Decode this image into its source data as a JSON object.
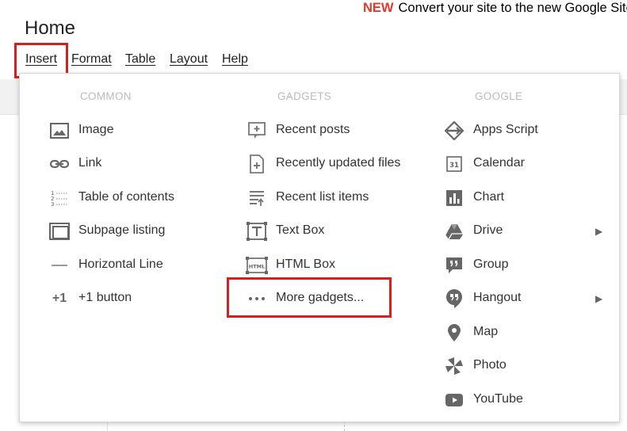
{
  "banner": {
    "new_label": "NEW",
    "text": "Convert your site to the new Google Site"
  },
  "page": {
    "title": "Home"
  },
  "menubar": {
    "items": [
      "Insert",
      "Format",
      "Table",
      "Layout",
      "Help"
    ]
  },
  "dropdown": {
    "columns": [
      {
        "header": "COMMON",
        "items": [
          {
            "label": "Image",
            "icon": "image-icon"
          },
          {
            "label": "Link",
            "icon": "link-icon"
          },
          {
            "label": "Table of contents",
            "icon": "table-of-contents-icon"
          },
          {
            "label": "Subpage listing",
            "icon": "subpage-listing-icon"
          },
          {
            "label": "Horizontal Line",
            "icon": "horizontal-line-icon"
          },
          {
            "label": "+1 button",
            "icon": "plus-one-icon"
          }
        ]
      },
      {
        "header": "GADGETS",
        "items": [
          {
            "label": "Recent posts",
            "icon": "recent-posts-icon"
          },
          {
            "label": "Recently updated files",
            "icon": "recent-files-icon"
          },
          {
            "label": "Recent list items",
            "icon": "recent-list-icon"
          },
          {
            "label": "Text Box",
            "icon": "text-box-icon"
          },
          {
            "label": "HTML Box",
            "icon": "html-box-icon"
          },
          {
            "label": "More gadgets...",
            "icon": "more-dots-icon"
          }
        ]
      },
      {
        "header": "GOOGLE",
        "items": [
          {
            "label": "Apps Script",
            "icon": "apps-script-icon"
          },
          {
            "label": "Calendar",
            "icon": "calendar-icon"
          },
          {
            "label": "Chart",
            "icon": "chart-icon"
          },
          {
            "label": "Drive",
            "icon": "drive-icon"
          },
          {
            "label": "Group",
            "icon": "group-icon"
          },
          {
            "label": "Hangout",
            "icon": "hangout-icon"
          },
          {
            "label": "Map",
            "icon": "map-pin-icon"
          },
          {
            "label": "Photo",
            "icon": "photo-icon"
          },
          {
            "label": "YouTube",
            "icon": "youtube-icon"
          }
        ]
      }
    ],
    "calendar_icon_text": "31",
    "plus_one_icon_text": "+1",
    "html_icon_text": "HTML",
    "submenu_arrow": "▶"
  },
  "colors": {
    "highlight": "#d81f1f",
    "new_badge": "#dd3b30",
    "header_gray": "#bbbbbb"
  }
}
